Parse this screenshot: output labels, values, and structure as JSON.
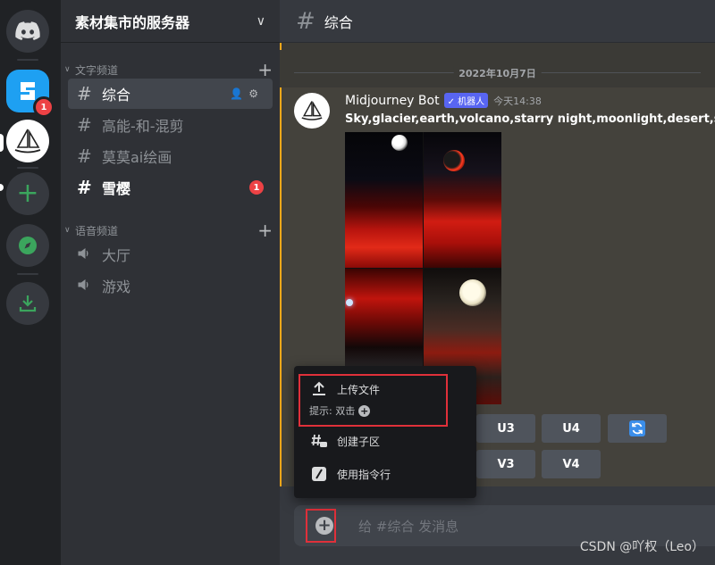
{
  "server": {
    "name": "素材集市的服务器"
  },
  "rail": {
    "sucai_badge": "1"
  },
  "categories": {
    "text": "文字频道",
    "voice": "语音频道"
  },
  "text_channels": [
    {
      "name": "综合"
    },
    {
      "name": "高能-和-混剪"
    },
    {
      "name": "莫莫ai绘画"
    },
    {
      "name": "雪樱",
      "badge": "1"
    }
  ],
  "voice_channels": [
    {
      "name": "大厅"
    },
    {
      "name": "游戏"
    }
  ],
  "header": {
    "channel": "综合"
  },
  "chat": {
    "date": "2022年10月7日",
    "author": "Midjourney Bot",
    "bot_tag": "✓ 机器人",
    "time": "今天14:38",
    "prompt": "Sky,glacier,earth,volcano,starry night,moonlight,desert,scar"
  },
  "buttons": {
    "u3": "U3",
    "u4": "U4",
    "v3": "V3",
    "v4": "V4"
  },
  "popup": {
    "upload": "上传文件",
    "hint_label": "提示: 双击",
    "create_thread": "创建子区",
    "use_command": "使用指令行"
  },
  "input": {
    "placeholder": "给 #综合 发消息"
  },
  "watermark": "CSDN @吖权（Leo）",
  "colors": {
    "accent": "#5865f2",
    "highlight": "#e0303a",
    "unread": "#ed4245"
  }
}
